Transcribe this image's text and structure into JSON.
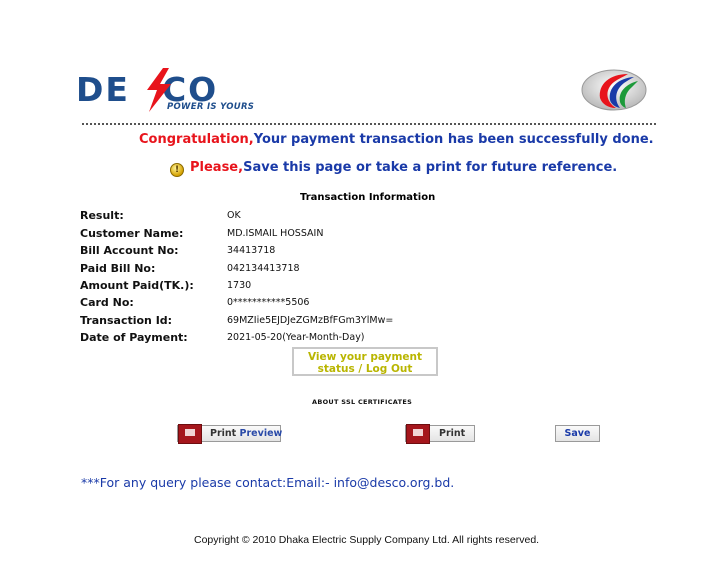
{
  "logo": {
    "brand": "DE CO",
    "brand_left": "DE",
    "brand_right": "CO",
    "tagline": "POWER IS YOURS",
    "color": "#1f4e8c",
    "bolt_color": "#e8141c"
  },
  "messages": {
    "congrats_prefix": "Congratulation,",
    "congrats_text": "Your payment transaction has been successfully done.",
    "please_prefix": "Please,",
    "please_text": "Save this page or take a print for future reference."
  },
  "transaction": {
    "title": "Transaction Information",
    "rows": [
      {
        "label": "Result:",
        "value": "OK"
      },
      {
        "label": "Customer Name:",
        "value": "MD.ISMAIL HOSSAIN"
      },
      {
        "label": "Bill Account No:",
        "value": "34413718"
      },
      {
        "label": "Paid Bill No:",
        "value": "042134413718"
      },
      {
        "label": "Amount Paid(TK.):",
        "value": "1730"
      },
      {
        "label": "Card No:",
        "value": "0***********5506"
      },
      {
        "label": "Transaction Id:",
        "value": "69MZIie5EJDJeZGMzBfFGm3YlMw="
      },
      {
        "label": "Date of Payment:",
        "value": "2021-05-20(Year-Month-Day)"
      }
    ]
  },
  "status_button": {
    "line1": "View your payment",
    "line2": "status / Log Out"
  },
  "ssl_link": "ABOUT SSL CERTIFICATES",
  "buttons": {
    "print_preview_a": "Print",
    "print_preview_b": "Preview",
    "print": "Print",
    "save": "Save"
  },
  "footer": {
    "query": "***For any query please contact:Email:- info@desco.org.bd.",
    "copyright": "Copyright © 2010 Dhaka Electric Supply Company Ltd. All rights reserved."
  },
  "colors": {
    "red": "#e8141c",
    "blue": "#1a3aa8",
    "olive": "#b9b500"
  },
  "icons": [
    "lightning-bolt-icon",
    "flag-emblem-icon",
    "warning-icon",
    "printer-icon"
  ]
}
